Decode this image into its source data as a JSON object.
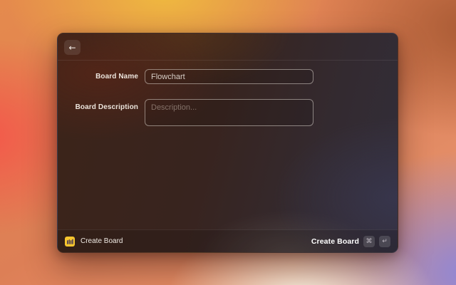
{
  "dialog": {
    "back_icon": "←",
    "form": {
      "name_label": "Board Name",
      "name_value": "Flowchart",
      "description_label": "Board Description",
      "description_placeholder": "Description..."
    },
    "footer": {
      "brand_label": "Create Board",
      "submit_label": "Create Board",
      "shortcut_keys": [
        "⌘",
        "↵"
      ]
    }
  },
  "colors": {
    "brand_yellow": "#f6c52e",
    "logo_glyph": "#211a5e",
    "dialog_base": "#38241f",
    "accent_text": "#ffffff"
  }
}
